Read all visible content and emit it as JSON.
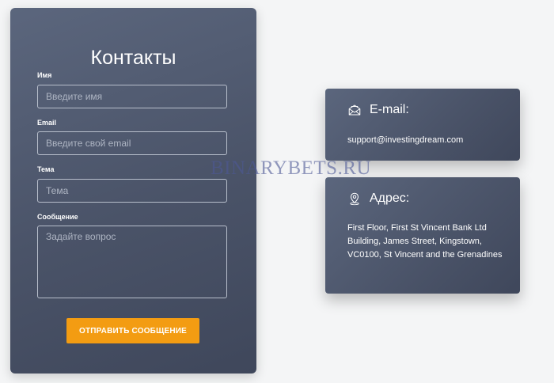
{
  "form": {
    "title": "Контакты",
    "name_label": "Имя",
    "name_placeholder": "Введите имя",
    "email_label": "Email",
    "email_placeholder": "Введите свой email",
    "subject_label": "Тема",
    "subject_placeholder": "Тема",
    "message_label": "Сообщение",
    "message_placeholder": "Задайте вопрос",
    "submit_label": "ОТПРАВИТЬ СООБЩЕНИЕ"
  },
  "email_card": {
    "title": "E-mail:",
    "icon": "envelope-icon",
    "value": "support@investingdream.com"
  },
  "address_card": {
    "title": "Адрес:",
    "icon": "location-pin-icon",
    "value": "First Floor, First St Vincent Bank Ltd Building, James Street, Kingstown, VC0100, St Vincent and the Grenadines"
  },
  "watermark": "BINARYBETS.RU",
  "colors": {
    "panel": "#4a5368",
    "accent": "#f39c12",
    "background": "#f4f5f6"
  }
}
